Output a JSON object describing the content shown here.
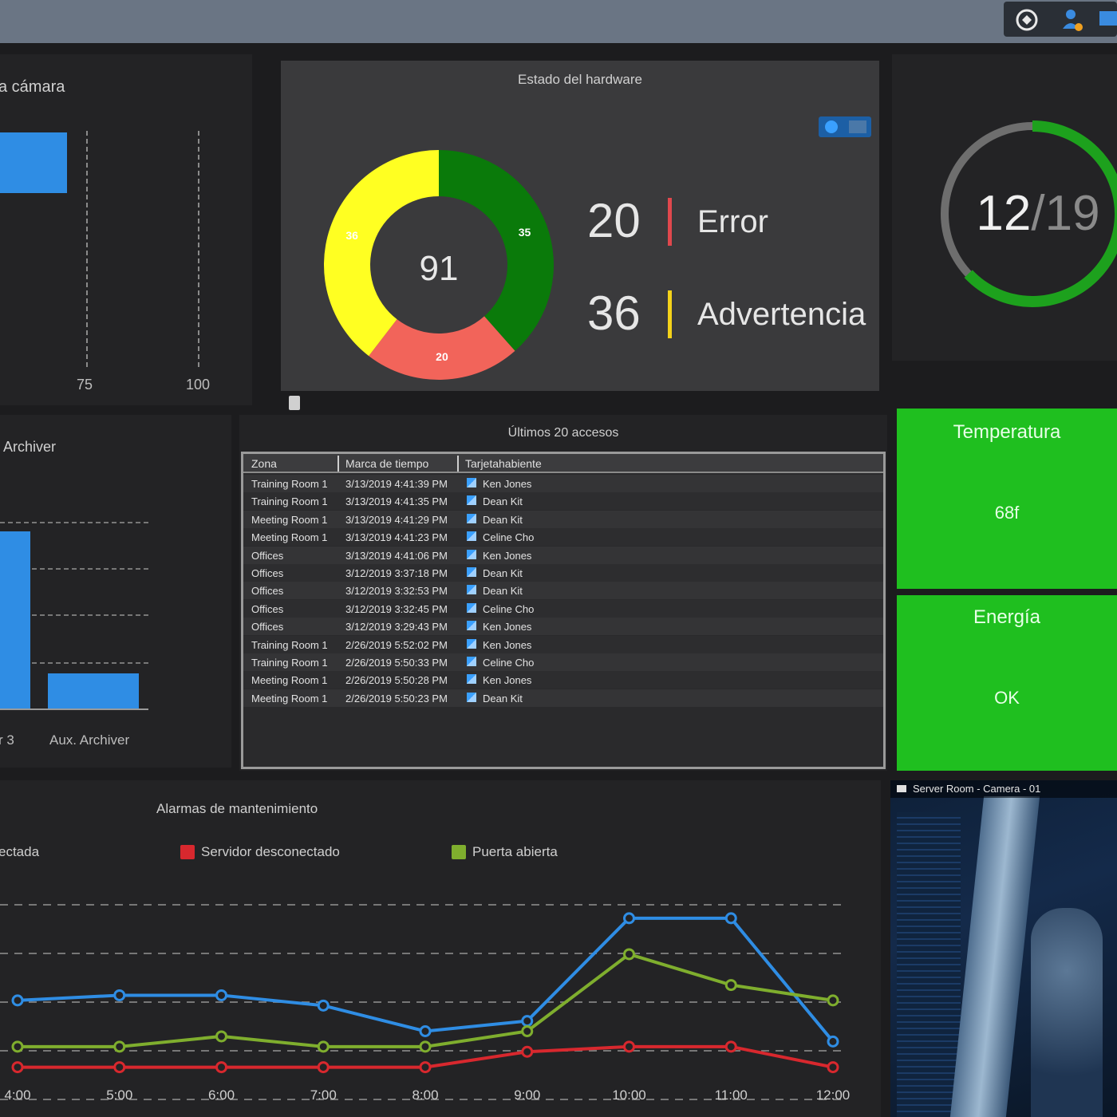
{
  "camera_panel": {
    "title": "a cámara",
    "ticks": [
      "75",
      "100"
    ]
  },
  "hardware": {
    "title": "Estado del hardware",
    "total": "91",
    "segments": [
      {
        "label": "35",
        "value": 35,
        "color": "#0a7a0a"
      },
      {
        "label": "20",
        "value": 20,
        "color": "#f2645a"
      },
      {
        "label": "36",
        "value": 36,
        "color": "#ffff22"
      }
    ],
    "error_count": "20",
    "error_label": "Error",
    "error_color": "#e0484d",
    "warning_count": "36",
    "warning_label": "Advertencia",
    "warning_color": "#f4d21a"
  },
  "ring": {
    "value": "12",
    "total": "/19",
    "fraction": 0.63
  },
  "archiver": {
    "title": "Archiver",
    "categories": [
      "r 3",
      "Aux. Archiver"
    ]
  },
  "access": {
    "title": "Últimos 20 accesos",
    "columns": [
      "Zona",
      "Marca de tiempo",
      "Tarjetahabiente"
    ],
    "rows": [
      [
        "Training Room 1",
        "3/13/2019 4:41:39 PM",
        "Ken Jones"
      ],
      [
        "Training Room 1",
        "3/13/2019 4:41:35 PM",
        "Dean Kit"
      ],
      [
        "Meeting Room 1",
        "3/13/2019 4:41:29 PM",
        "Dean Kit"
      ],
      [
        "Meeting Room 1",
        "3/13/2019 4:41:23 PM",
        "Celine Cho"
      ],
      [
        "Offices",
        "3/13/2019 4:41:06 PM",
        "Ken Jones"
      ],
      [
        "Offices",
        "3/12/2019 3:37:18 PM",
        "Dean Kit"
      ],
      [
        "Offices",
        "3/12/2019 3:32:53 PM",
        "Dean Kit"
      ],
      [
        "Offices",
        "3/12/2019 3:32:45 PM",
        "Celine Cho"
      ],
      [
        "Offices",
        "3/12/2019 3:29:43 PM",
        "Ken Jones"
      ],
      [
        "Training Room 1",
        "2/26/2019 5:52:02 PM",
        "Ken Jones"
      ],
      [
        "Training Room 1",
        "2/26/2019 5:50:33 PM",
        "Celine Cho"
      ],
      [
        "Meeting Room 1",
        "2/26/2019 5:50:28 PM",
        "Ken Jones"
      ],
      [
        "Meeting Room 1",
        "2/26/2019 5:50:23 PM",
        "Dean Kit"
      ]
    ]
  },
  "temperature": {
    "title": "Temperatura",
    "value": "68f"
  },
  "energy": {
    "title": "Energía",
    "value": "OK"
  },
  "camera_feed": {
    "title": "Server Room - Camera - 01"
  },
  "chart_data": {
    "type": "line",
    "title": "Alarmas de mantenimiento",
    "x": [
      "4:00",
      "5:00",
      "6:00",
      "7:00",
      "8:00",
      "9:00",
      "10:00",
      "11:00",
      "12:00"
    ],
    "series": [
      {
        "name": "ectada",
        "color": "#2f8de4",
        "values": [
          14,
          15,
          15,
          13,
          8,
          10,
          30,
          30,
          6
        ]
      },
      {
        "name": "Servidor desconectado",
        "color": "#d8282e",
        "values": [
          1,
          1,
          1,
          1,
          1,
          4,
          5,
          5,
          1
        ]
      },
      {
        "name": "Puerta abierta",
        "color": "#7fae2e",
        "values": [
          5,
          5,
          7,
          5,
          5,
          8,
          23,
          17,
          14
        ]
      }
    ],
    "ylim": [
      0,
      40
    ],
    "grid": true,
    "legend": "top"
  }
}
